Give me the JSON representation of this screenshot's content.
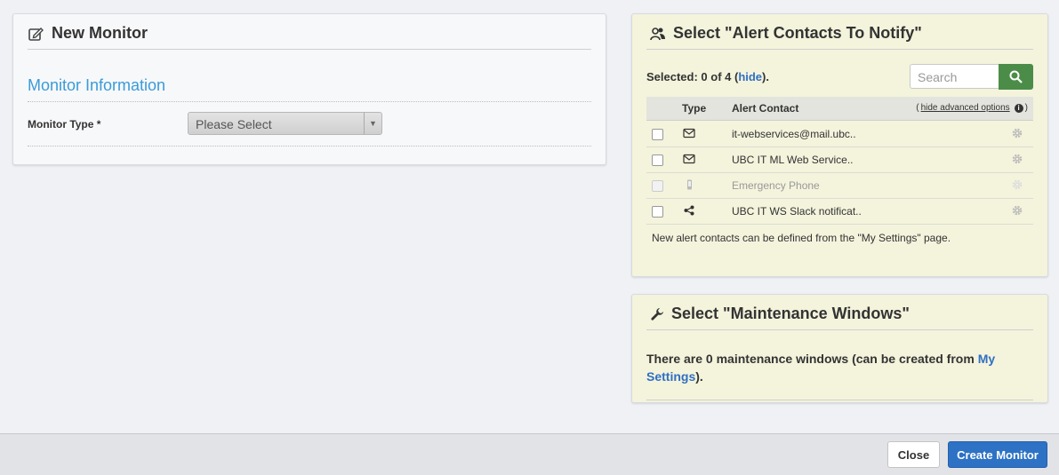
{
  "new_monitor": {
    "title": "New Monitor",
    "section_title": "Monitor Information",
    "monitor_type_label": "Monitor Type *",
    "monitor_type_value": "Please Select"
  },
  "alert_contacts": {
    "title": "Select \"Alert Contacts To Notify\"",
    "selected_prefix": "Selected: 0 of 4 (",
    "hide_link": "hide",
    "selected_suffix": ").",
    "search_placeholder": "Search",
    "columns": {
      "type": "Type",
      "contact": "Alert Contact"
    },
    "advanced_paren_open": "(",
    "advanced_link": "hide advanced options",
    "advanced_paren_close": ")",
    "rows": [
      {
        "icon": "envelope-icon",
        "name": "it-webservices@mail.ubc..",
        "enabled": true
      },
      {
        "icon": "envelope-icon",
        "name": "UBC IT ML Web Service..",
        "enabled": true
      },
      {
        "icon": "mobile-phone-icon",
        "name": "Emergency Phone",
        "enabled": false
      },
      {
        "icon": "share-icon",
        "name": "UBC IT WS Slack notificat..",
        "enabled": true
      }
    ],
    "note": "New alert contacts can be defined from the \"My Settings\" page."
  },
  "maintenance": {
    "title": "Select \"Maintenance Windows\"",
    "text_before": "There are 0 maintenance windows (can be created from ",
    "link": "My Settings",
    "text_after": ")."
  },
  "footer": {
    "close_label": "Close",
    "create_label": "Create Monitor"
  },
  "colors": {
    "accent_blue": "#2d72c4",
    "search_green": "#4b8d48",
    "panel_yellow": "#f4f3dc",
    "section_blue": "#3a9bd9"
  }
}
